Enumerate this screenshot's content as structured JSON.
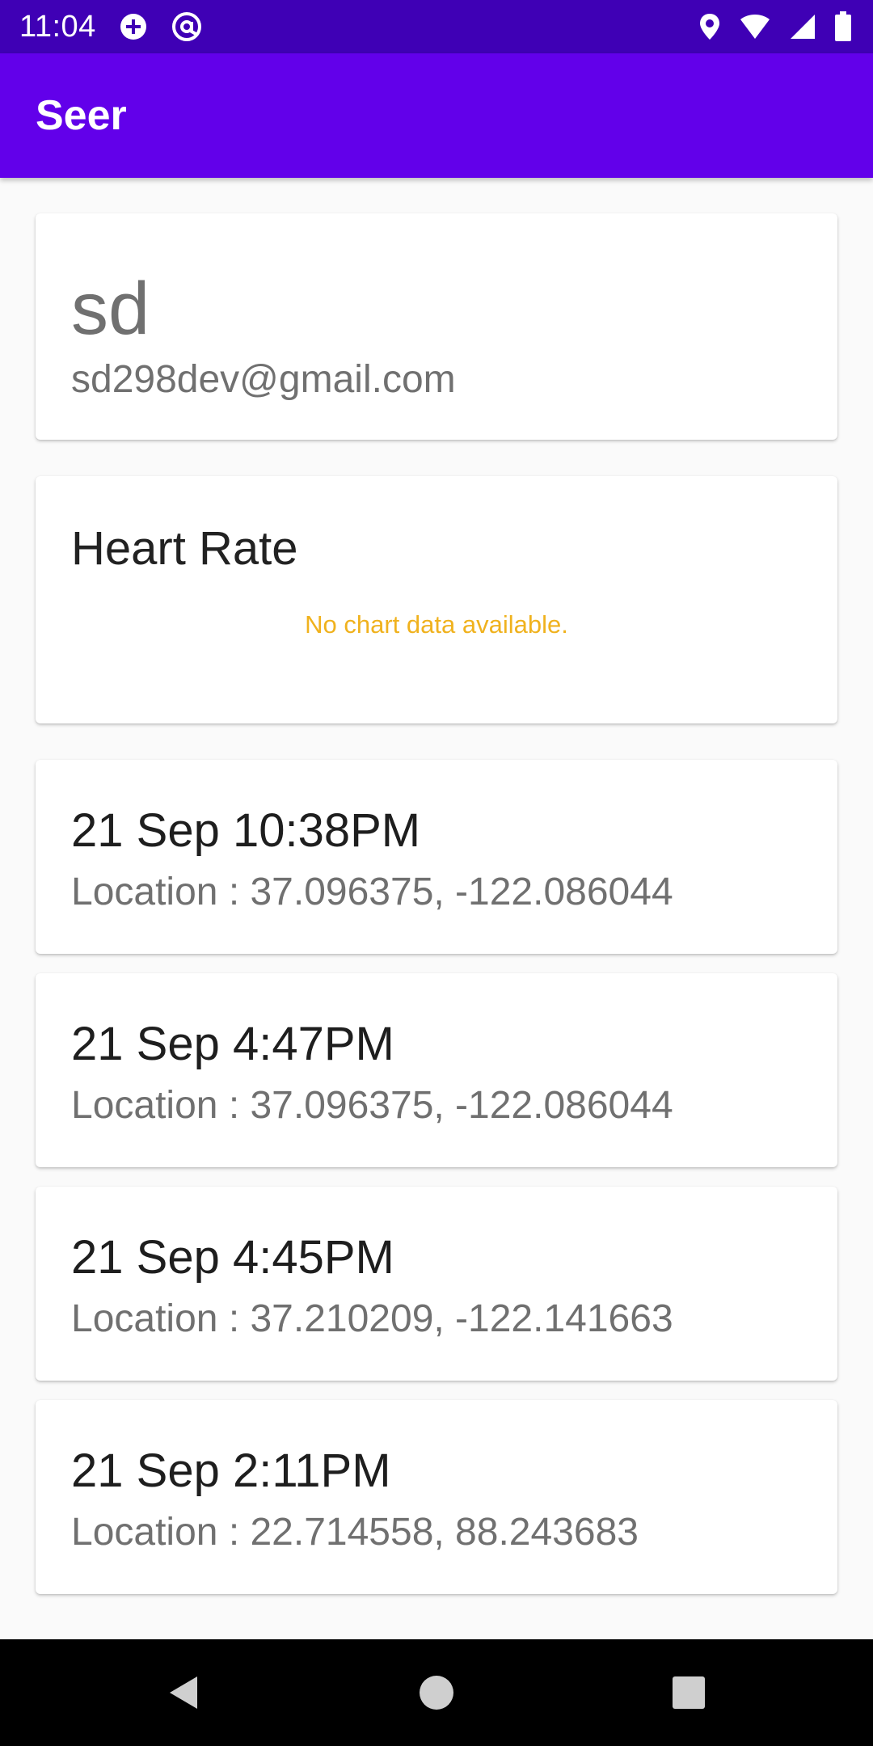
{
  "status_bar": {
    "time": "11:04",
    "left_icons": [
      "add-circle-icon",
      "at-sign-icon"
    ],
    "right_icons": [
      "location-pin-icon",
      "wifi-icon",
      "cell-signal-icon",
      "battery-icon"
    ]
  },
  "app_bar": {
    "title": "Seer",
    "color": "#6200ea"
  },
  "profile": {
    "name": "sd",
    "email": "sd298dev@gmail.com"
  },
  "heart_rate": {
    "title": "Heart Rate",
    "empty_message": "No chart data available."
  },
  "entries": [
    {
      "time": "21 Sep 10:38PM",
      "location": "Location : 37.096375, -122.086044"
    },
    {
      "time": "21 Sep 4:47PM",
      "location": "Location : 37.096375, -122.086044"
    },
    {
      "time": "21 Sep 4:45PM",
      "location": "Location : 37.210209, -122.141663"
    },
    {
      "time": "21 Sep 2:11PM",
      "location": "Location : 22.714558, 88.243683"
    }
  ],
  "nav_bar": {
    "icons": [
      "back-icon",
      "home-icon",
      "recents-icon"
    ]
  }
}
